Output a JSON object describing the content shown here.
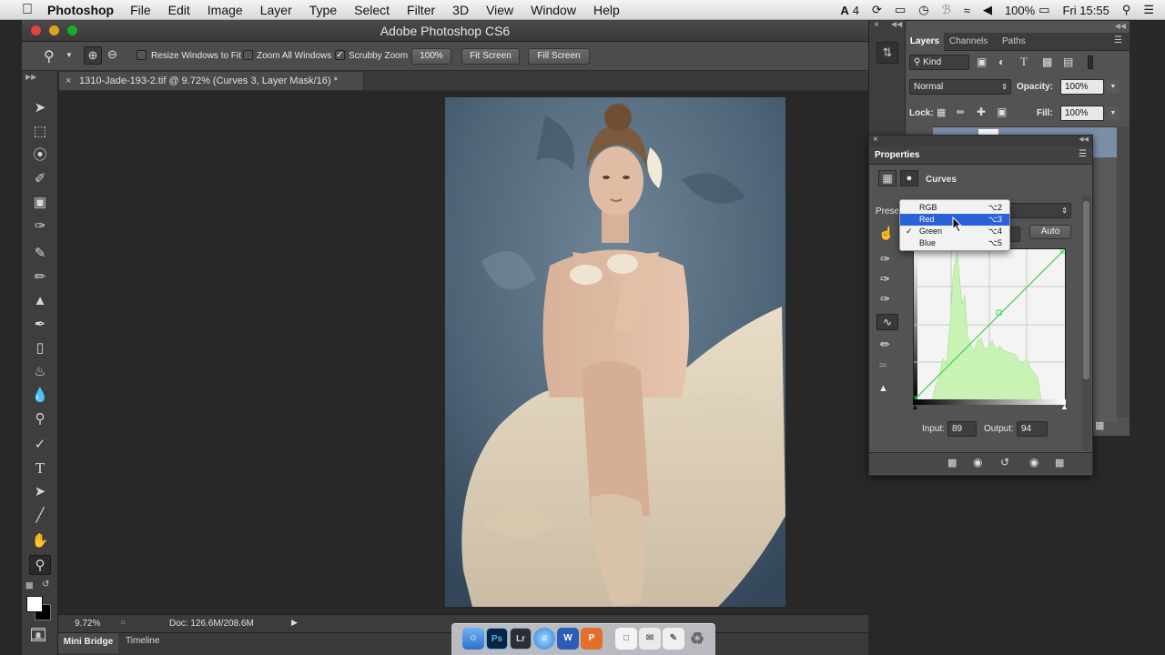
{
  "menubar": {
    "app": "Photoshop",
    "menus": [
      "File",
      "Edit",
      "Image",
      "Layer",
      "Type",
      "Select",
      "Filter",
      "3D",
      "View",
      "Window",
      "Help"
    ],
    "status_badge": "4",
    "battery": "100%",
    "clock": "Fri 15:55"
  },
  "window": {
    "title": "Adobe Photoshop CS6"
  },
  "options": {
    "resize_windows_label": "Resize Windows to Fit",
    "zoom_all_label": "Zoom All Windows",
    "scrubby_label": "Scrubby Zoom",
    "zoom_100": "100%",
    "fit_screen": "Fit Screen",
    "fill_screen": "Fill Screen"
  },
  "document": {
    "tab_title": "1310-Jade-193-2.tif @ 9.72% (Curves 3, Layer Mask/16) *"
  },
  "statusbar": {
    "zoom": "9.72%",
    "doc": "Doc: 126.6M/208.6M"
  },
  "bottom_tabs": [
    "Mini Bridge",
    "Timeline"
  ],
  "layers_panel": {
    "tabs": [
      "Layers",
      "Channels",
      "Paths"
    ],
    "kind": "Kind",
    "blend_mode": "Normal",
    "opacity_label": "Opacity:",
    "opacity": "100%",
    "lock_label": "Lock:",
    "fill_label": "Fill:",
    "fill": "100%"
  },
  "properties": {
    "title": "Properties",
    "adjustment": "Curves",
    "preset_label": "Preset",
    "auto_label": "Auto",
    "input_label": "Input:",
    "input_value": "89",
    "output_label": "Output:",
    "output_value": "94"
  },
  "channel_menu": {
    "items": [
      {
        "label": "RGB",
        "shortcut": "⌥2",
        "checked": false,
        "highlighted": false
      },
      {
        "label": "Red",
        "shortcut": "⌥3",
        "checked": false,
        "highlighted": true
      },
      {
        "label": "Green",
        "shortcut": "⌥4",
        "checked": true,
        "highlighted": false
      },
      {
        "label": "Blue",
        "shortcut": "⌥5",
        "checked": false,
        "highlighted": false
      }
    ]
  },
  "colors": {
    "highlight": "#2a62d9",
    "curve_line": "#3ed24a",
    "histogram_fill": "#c9f2b5"
  },
  "dock": {
    "icons": [
      "finder-icon",
      "photoshop-icon",
      "lightroom-icon",
      "itunes-icon",
      "word-icon",
      "powerpoint-icon",
      "preview-icon",
      "mail-icon",
      "notes-icon",
      "trash-icon"
    ],
    "ps_label": "Ps",
    "lr_label": "Lr"
  }
}
